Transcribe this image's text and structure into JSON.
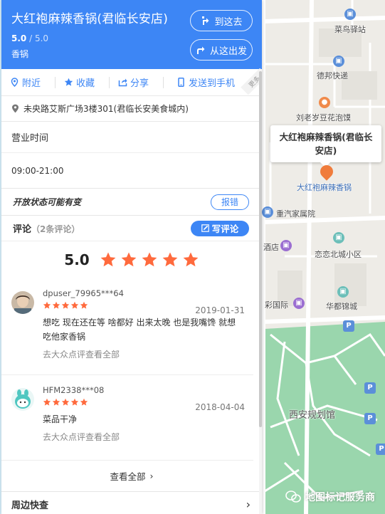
{
  "panel": {
    "title": "大红袍麻辣香锅(君临长安店)",
    "rating_value": "5.0",
    "rating_total": "/ 5.0",
    "category": "香锅",
    "btn_route_to": "到这去",
    "btn_route_from": "从这出发",
    "actions": {
      "nearby": "附近",
      "favorite": "收藏",
      "share": "分享",
      "send_phone": "发送到手机",
      "more_tag": "更多"
    },
    "address": "未央路艾斯广场3楼301(君临长安美食城内)",
    "hours_label": "营业时间",
    "hours_value": "09:00-21:00",
    "status_note": "开放状态可能有变",
    "report_label": "报错",
    "review_label": "评论",
    "review_count": "（2条评论）",
    "write_review": "写评论",
    "overall_score": "5.0",
    "overall_stars": 5,
    "reviews": [
      {
        "user": "dpuser_79965***64",
        "stars": 5,
        "date": "2019-01-31",
        "text": "想吃 现在还在等 啥都好 出来太晚 也是我嘴馋 就想吃他家香锅",
        "source": "去大众点评查看全部"
      },
      {
        "user": "HFM2338***08",
        "stars": 5,
        "date": "2018-04-04",
        "text": "菜品干净",
        "source": "去大众点评查看全部"
      }
    ],
    "see_all": "查看全部",
    "nearby_search": "周边快查"
  },
  "map": {
    "pois": {
      "cainiao": "菜鸟驿站",
      "debang": "德邦快递",
      "liulaoer": "刘老岁豆花泡馍",
      "zhongqi": "重汽家属院",
      "jiudian": "酒店",
      "lianlian": "恋恋北城小区",
      "caiguoji": "彩国际",
      "huadu": "华都锦城",
      "guihuaguan": "西安规划馆"
    },
    "callout_title": "大红袍麻辣香锅(君临长安店)",
    "marker_label": "大红袍麻辣香锅",
    "watermark": "地图标记服务商"
  },
  "colors": {
    "brand_blue": "#3d86f5",
    "star_orange": "#ff6a3d",
    "park_green": "#8fd1a4"
  }
}
